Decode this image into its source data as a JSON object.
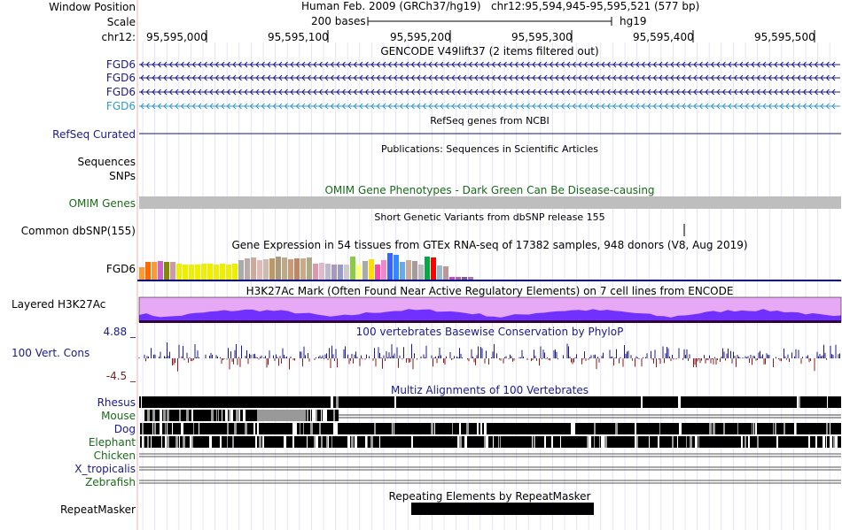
{
  "header": {
    "window_position_label": "Window Position",
    "assembly": "Human Feb. 2009 (GRCh37/hg19)",
    "position": "chr12:95,594,945-95,595,521 (577 bp)",
    "scale_label": "Scale",
    "scale_bar_text": "200 bases",
    "scale_db": "hg19",
    "chrom_label": "chr12:"
  },
  "ruler_ticks": [
    "95,595,000",
    "95,595,100",
    "95,595,200",
    "95,595,300",
    "95,595,400",
    "95,595,500"
  ],
  "tracks": {
    "gencode": {
      "title": "GENCODE V49lift37 (2 items filtered out)",
      "genes": [
        "FGD6",
        "FGD6",
        "FGD6",
        "FGD6"
      ],
      "colors": [
        "#1a1a8c",
        "#1a1a8c",
        "#1a1a8c",
        "#3399cc"
      ]
    },
    "refseq": {
      "title": "RefSeq genes from NCBI",
      "label": "RefSeq Curated"
    },
    "publications": {
      "title": "Publications: Sequences in Scientific Articles",
      "labels": [
        "Sequences",
        "SNPs"
      ]
    },
    "omim": {
      "title": "OMIM Gene Phenotypes - Dark Green Can Be Disease-causing",
      "label": "OMIM Genes",
      "color": "#bebebe",
      "title_color": "#1a6a1a"
    },
    "dbsnp": {
      "title": "Short Genetic Variants from dbSNP release 155",
      "label": "Common dbSNP(155)"
    },
    "gtex": {
      "title": "Gene Expression in 54 tissues from GTEx RNA-seq of 17382 samples, 948 donors (V8, Aug 2019)",
      "label": "FGD6"
    },
    "h3k27ac": {
      "title": "H3K27Ac Mark (Often Found Near Active Regulatory Elements) on 7 cell lines from ENCODE",
      "label": "Layered H3K27Ac"
    },
    "conservation": {
      "title": "100 vertebrates Basewise Conservation by PhyloP",
      "label": "100 Vert. Cons",
      "max_label": "4.88 _",
      "min_label": "-4.5 _"
    },
    "multiz": {
      "title": "Multiz Alignments of 100 Vertebrates",
      "species": [
        "Rhesus",
        "Mouse",
        "Dog",
        "Elephant",
        "Chicken",
        "X_tropicalis",
        "Zebrafish"
      ]
    },
    "repeatmasker": {
      "title": "Repeating Elements by RepeatMasker",
      "label": "RepeatMasker"
    }
  }
}
